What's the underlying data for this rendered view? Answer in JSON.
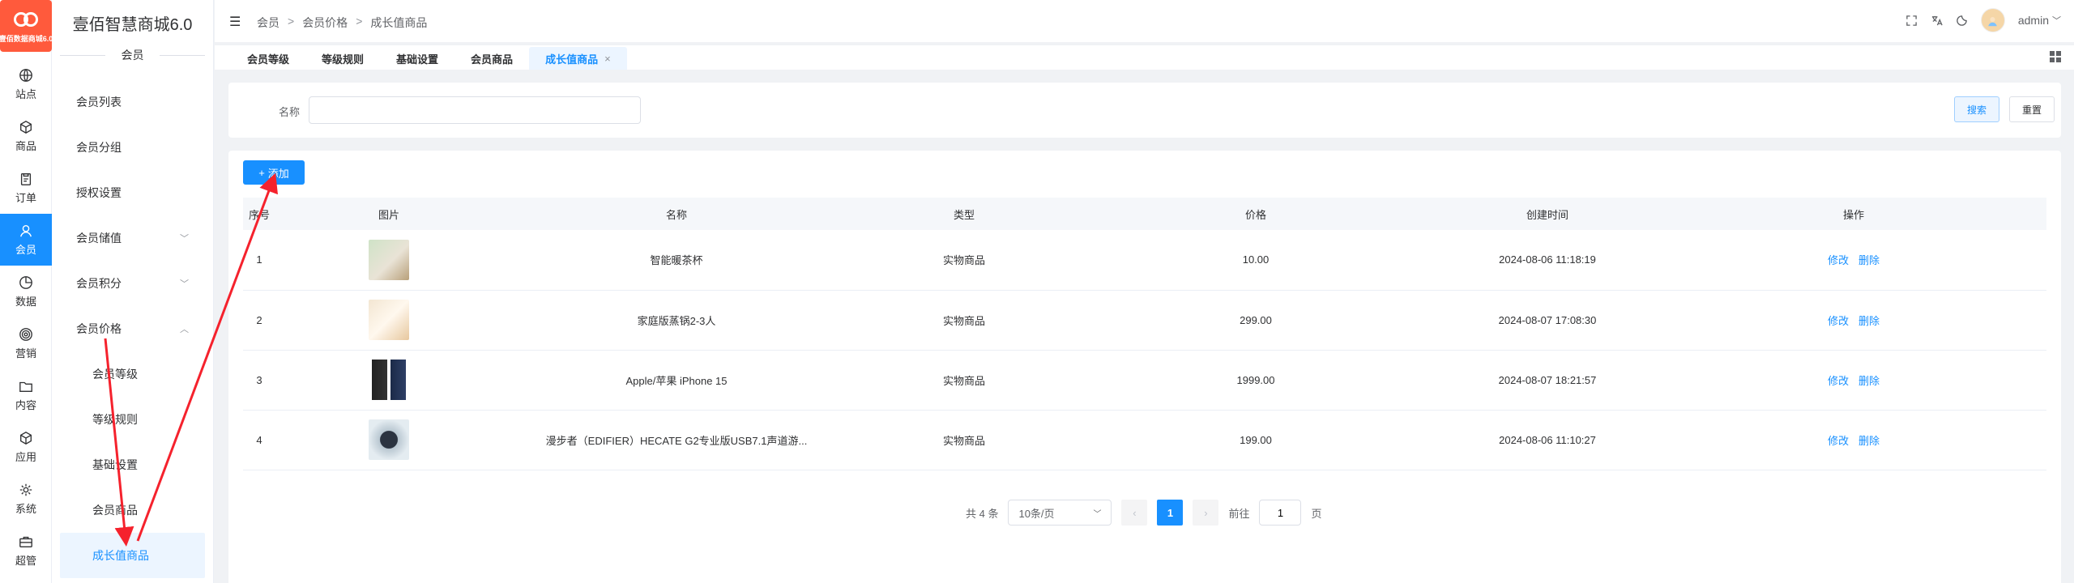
{
  "brand": {
    "logo_text": "壹佰数据商城6.0",
    "app_title": "壹佰智慧商城6.0",
    "section_title": "会员"
  },
  "rail": [
    {
      "label": "站点",
      "icon": "globe-icon"
    },
    {
      "label": "商品",
      "icon": "box-icon"
    },
    {
      "label": "订单",
      "icon": "clipboard-icon"
    },
    {
      "label": "会员",
      "icon": "user-icon"
    },
    {
      "label": "数据",
      "icon": "pie-chart-icon"
    },
    {
      "label": "营销",
      "icon": "target-icon"
    },
    {
      "label": "内容",
      "icon": "folder-icon"
    },
    {
      "label": "应用",
      "icon": "cube-icon"
    },
    {
      "label": "系统",
      "icon": "gear-icon"
    },
    {
      "label": "超管",
      "icon": "briefcase-icon"
    }
  ],
  "menu": {
    "items": [
      "会员列表",
      "会员分组",
      "授权设置",
      "会员储值",
      "会员积分",
      "会员价格"
    ],
    "submenu": [
      "会员等级",
      "等级规则",
      "基础设置",
      "会员商品",
      "成长值商品"
    ]
  },
  "header": {
    "breadcrumb": [
      "会员",
      "会员价格",
      "成长值商品"
    ],
    "sep": ">",
    "user": "admin"
  },
  "tabs": [
    "会员等级",
    "等级规则",
    "基础设置",
    "会员商品",
    "成长值商品"
  ],
  "search": {
    "label": "名称",
    "value": "",
    "search_btn": "搜索",
    "reset_btn": "重置"
  },
  "table": {
    "add_btn": "添加",
    "columns": [
      "序号",
      "图片",
      "名称",
      "类型",
      "价格",
      "创建时间",
      "操作"
    ],
    "rows": [
      {
        "no": "1",
        "name": "智能暖茶杯",
        "type": "实物商品",
        "price": "10.00",
        "created": "2024-08-06 11:18:19"
      },
      {
        "no": "2",
        "name": "家庭版蒸锅2-3人",
        "type": "实物商品",
        "price": "299.00",
        "created": "2024-08-07 17:08:30"
      },
      {
        "no": "3",
        "name": "Apple/苹果 iPhone 15",
        "type": "实物商品",
        "price": "1999.00",
        "created": "2024-08-07 18:21:57"
      },
      {
        "no": "4",
        "name": "漫步者（EDIFIER）HECATE G2专业版USB7.1声道游...",
        "type": "实物商品",
        "price": "199.00",
        "created": "2024-08-06 11:10:27"
      }
    ],
    "edit_label": "修改",
    "delete_label": "删除"
  },
  "pagination": {
    "total": "共 4 条",
    "page_size": "10条/页",
    "current": "1",
    "goto_label": "前往",
    "goto_value": "1",
    "page_suffix": "页"
  },
  "colors": {
    "primary": "#1890ff",
    "annotation": "#f5222d",
    "logo": "#ff5a3c"
  }
}
